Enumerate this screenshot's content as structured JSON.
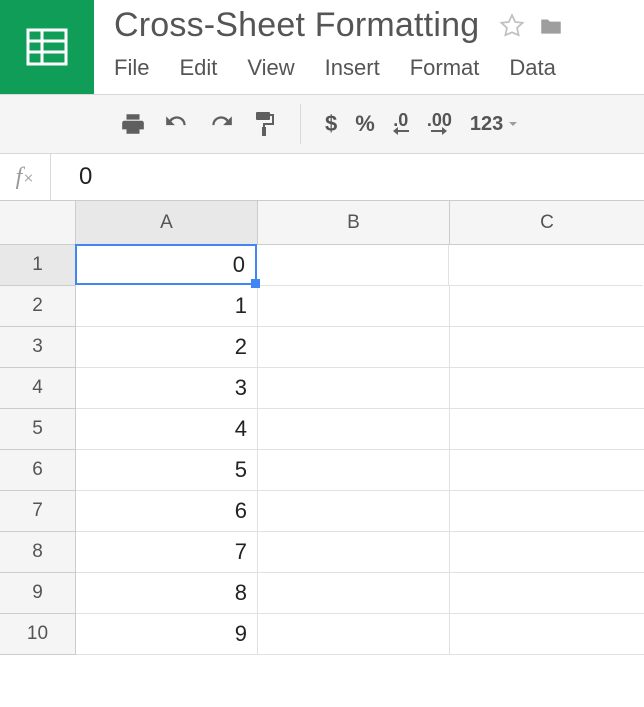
{
  "doc": {
    "title": "Cross-Sheet Formatting"
  },
  "menu": {
    "file": "File",
    "edit": "Edit",
    "view": "View",
    "insert": "Insert",
    "format": "Format",
    "data": "Data"
  },
  "toolbar": {
    "currency": "$",
    "percent": "%",
    "dec_decrease": ".0",
    "dec_increase": ".00",
    "more_formats": "123"
  },
  "formula": {
    "fx": "fx",
    "value": "0"
  },
  "columns": {
    "a": "A",
    "b": "B",
    "c": "C"
  },
  "rows": [
    {
      "n": "1",
      "a": "0",
      "b": "",
      "c": ""
    },
    {
      "n": "2",
      "a": "1",
      "b": "",
      "c": ""
    },
    {
      "n": "3",
      "a": "2",
      "b": "",
      "c": ""
    },
    {
      "n": "4",
      "a": "3",
      "b": "",
      "c": ""
    },
    {
      "n": "5",
      "a": "4",
      "b": "",
      "c": ""
    },
    {
      "n": "6",
      "a": "5",
      "b": "",
      "c": ""
    },
    {
      "n": "7",
      "a": "6",
      "b": "",
      "c": ""
    },
    {
      "n": "8",
      "a": "7",
      "b": "",
      "c": ""
    },
    {
      "n": "9",
      "a": "8",
      "b": "",
      "c": ""
    },
    {
      "n": "10",
      "a": "9",
      "b": "",
      "c": ""
    }
  ],
  "selected": {
    "row": 0,
    "col": "a"
  }
}
